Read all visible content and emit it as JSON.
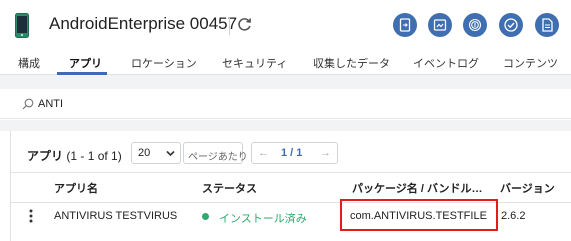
{
  "header": {
    "device_name": "AndroidEnterprise 00457",
    "accent_color": "#3f6fb0",
    "icons": [
      "phone-icon",
      "refresh-icon",
      "remote-view-icon",
      "screenshot-icon",
      "fingerprint-icon",
      "check-circle-icon",
      "document-icon"
    ]
  },
  "tabs": [
    {
      "label": "構成",
      "active": false
    },
    {
      "label": "アプリ",
      "active": true
    },
    {
      "label": "ロケーション",
      "active": false
    },
    {
      "label": "セキュリティ",
      "active": false
    },
    {
      "label": "収集したデータ",
      "active": false
    },
    {
      "label": "イベントログ",
      "active": false
    },
    {
      "label": "コンテンツ",
      "active": false
    }
  ],
  "search": {
    "value": "ANTI"
  },
  "apps_list": {
    "title": "アプリ",
    "range": "(1 - 1 of 1)",
    "per_page": "20",
    "per_page_label": "ページあたり",
    "pager": {
      "prev": "←",
      "page": "1 / 1",
      "next": "→"
    },
    "columns": [
      "アプリ名",
      "ステータス",
      "パッケージ名 / バンドル…",
      "バージョン"
    ],
    "rows": [
      {
        "name": "ANTIVIRUS TESTVIRUS",
        "status": "インストール済み",
        "package": "com.ANTIVIRUS.TESTFILE",
        "version": "2.6.2"
      }
    ]
  },
  "colors": {
    "status_installed": "#2eaa6e",
    "highlight": "#e21b1b",
    "active_tab": "#3d6cb3"
  }
}
